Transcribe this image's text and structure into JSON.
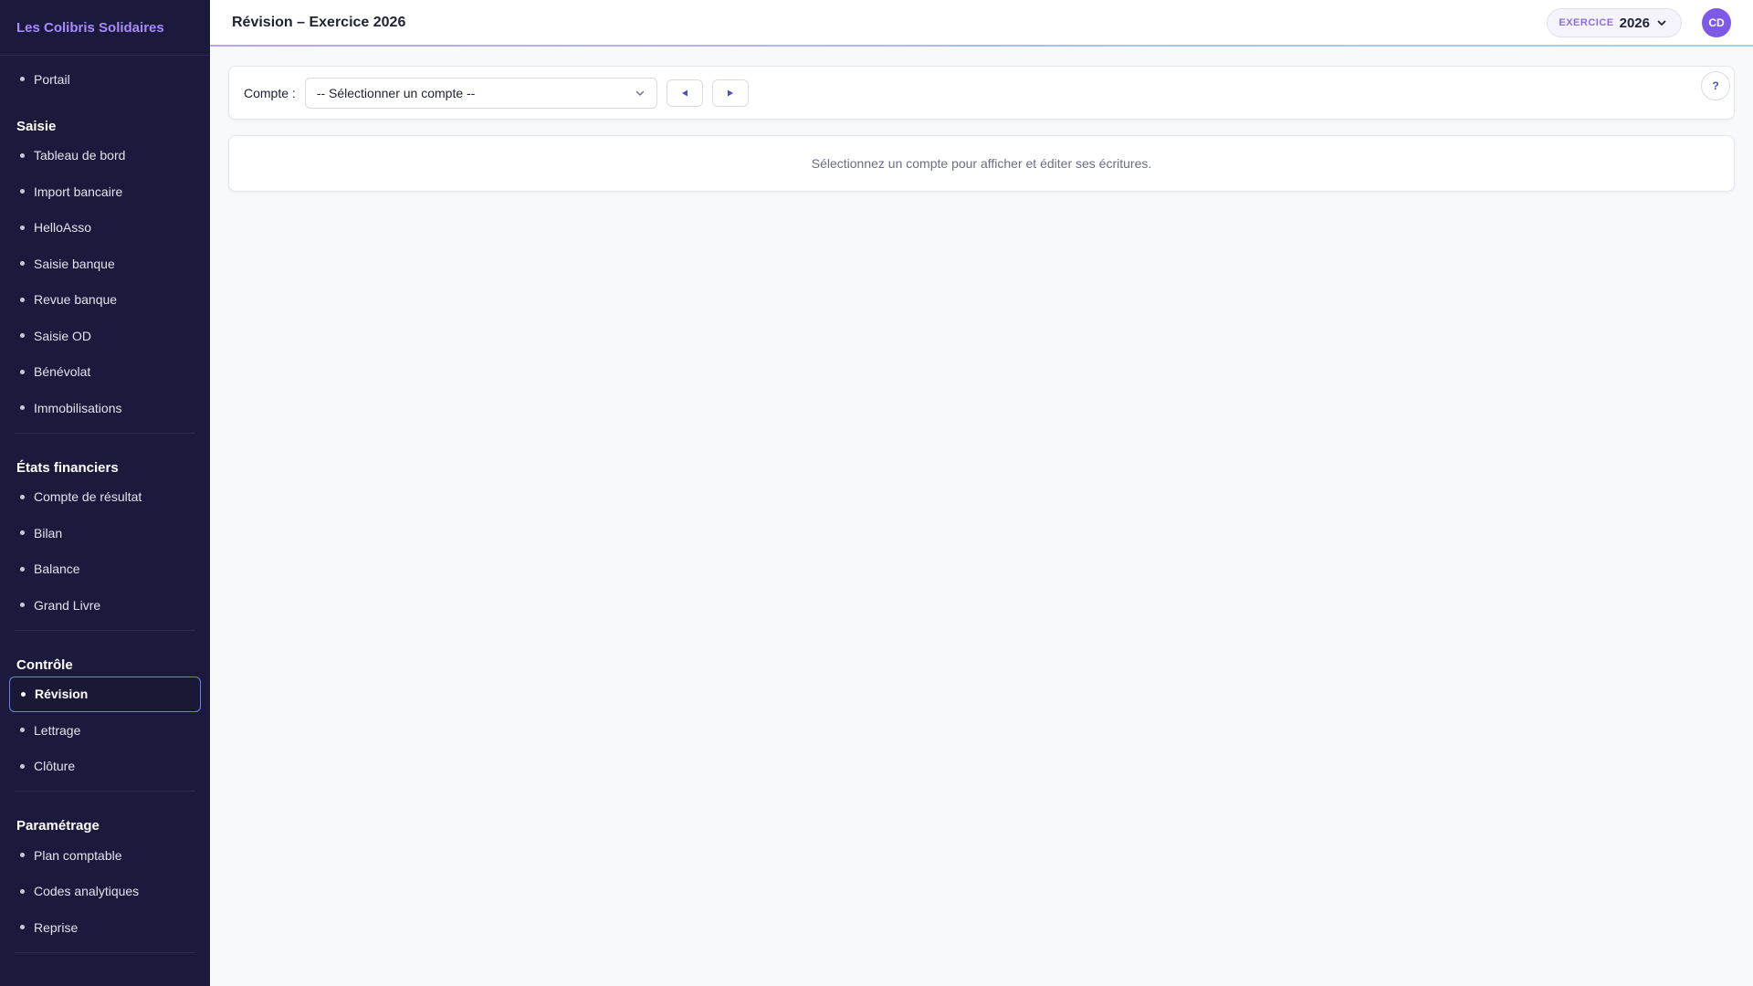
{
  "sidebar": {
    "brand": "Les Colibris Solidaires",
    "portal": "Portail",
    "sections": [
      {
        "title": "Saisie",
        "items": [
          "Tableau de bord",
          "Import bancaire",
          "HelloAsso",
          "Saisie banque",
          "Revue banque",
          "Saisie OD",
          "Bénévolat",
          "Immobilisations"
        ]
      },
      {
        "title": "États financiers",
        "items": [
          "Compte de résultat",
          "Bilan",
          "Balance",
          "Grand Livre"
        ]
      },
      {
        "title": "Contrôle",
        "items": [
          "Révision",
          "Lettrage",
          "Clôture"
        ]
      },
      {
        "title": "Paramétrage",
        "items": [
          "Plan comptable",
          "Codes analytiques",
          "Reprise"
        ]
      }
    ],
    "active_item": "Révision"
  },
  "header": {
    "title": "Révision – Exercice 2026",
    "exercise_label": "EXERCICE",
    "exercise_year": "2026",
    "avatar_initials": "CD"
  },
  "toolbar": {
    "compte_label": "Compte :",
    "select_value": "-- Sélectionner un compte --",
    "prev_icon": "◀",
    "next_icon": "▶",
    "help_label": "?"
  },
  "empty_state": {
    "message": "Sélectionnez un compte pour afficher et éditer ses écritures."
  },
  "colors": {
    "sidebar_bg": "#1c1a3c",
    "brand": "#a78bfa",
    "accent": "#7c5ae6",
    "nav_arrow": "#4b4fc4"
  }
}
